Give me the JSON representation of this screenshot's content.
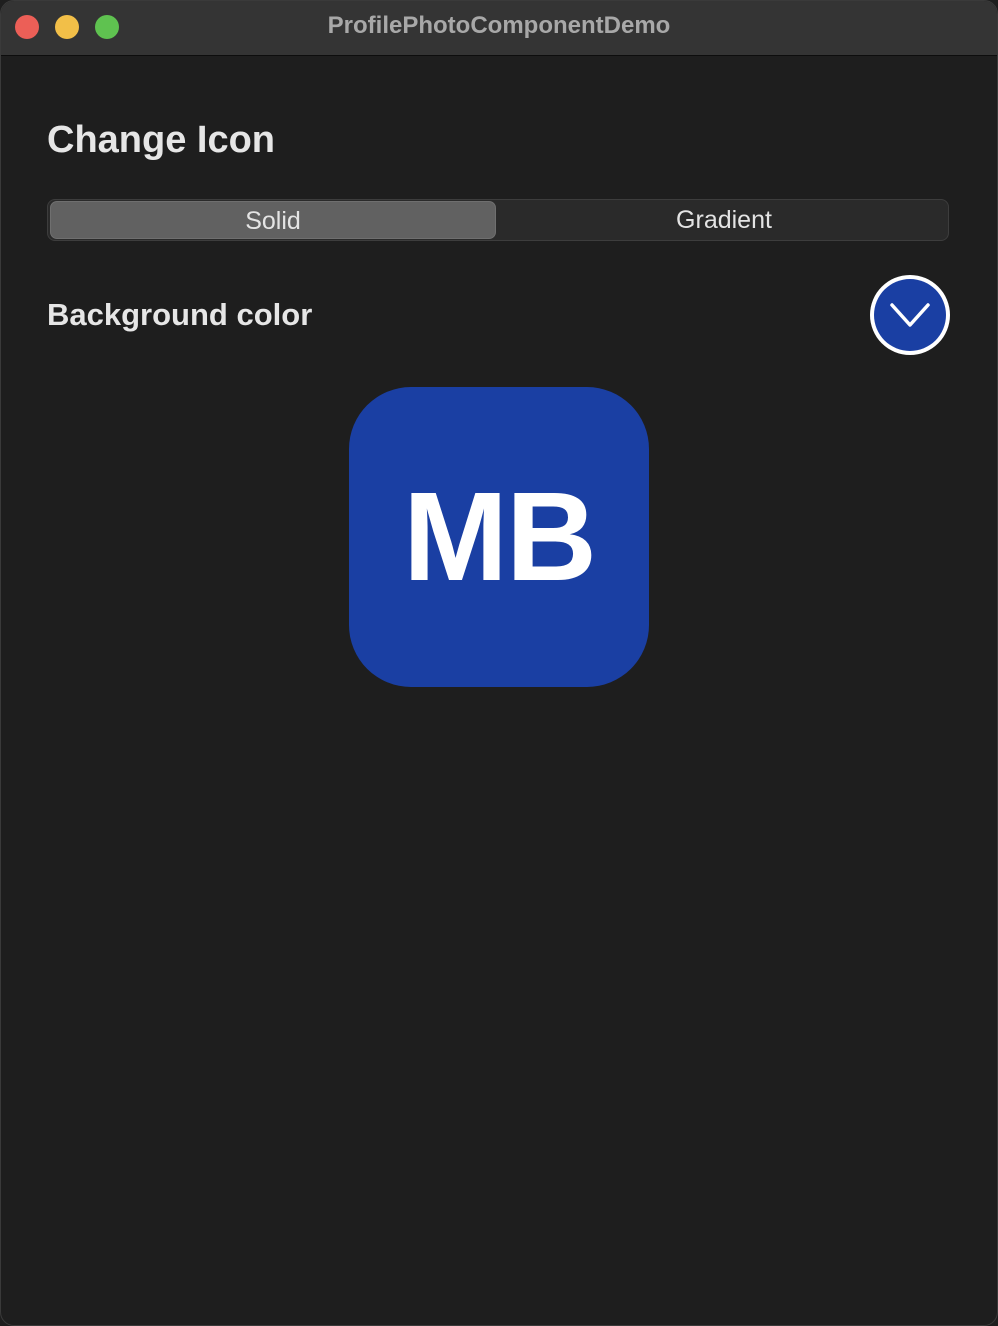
{
  "window": {
    "title": "ProfilePhotoComponentDemo"
  },
  "main": {
    "heading": "Change Icon",
    "segments": [
      {
        "label": "Solid",
        "selected": true
      },
      {
        "label": "Gradient",
        "selected": false
      }
    ],
    "background_color_label": "Background color",
    "color_picker": {
      "icon": "chevron-down-icon",
      "color": "#1a3fa3"
    },
    "avatar": {
      "initials": "MB",
      "background_color": "#1a3fa3"
    }
  },
  "colors": {
    "window_background": "#1e1e1e",
    "titlebar": "#343434",
    "accent_blue": "#1a3fa3",
    "close": "#ec5f57",
    "minimize": "#f2bf48",
    "zoom": "#5fc250"
  }
}
